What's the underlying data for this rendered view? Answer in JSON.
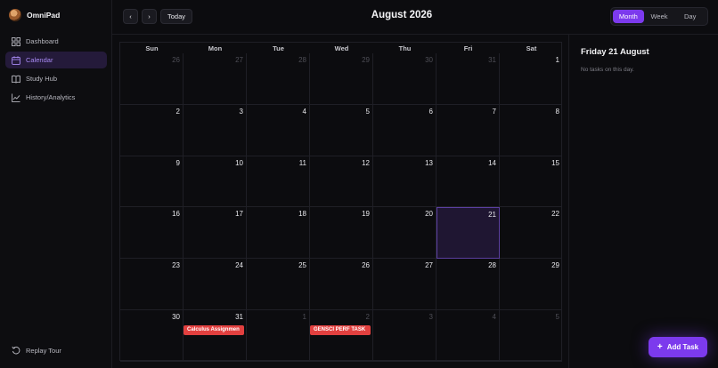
{
  "app": {
    "name": "OmniPad"
  },
  "sidebar": {
    "items": [
      {
        "label": "Dashboard",
        "icon": "dashboard-icon",
        "active": false
      },
      {
        "label": "Calendar",
        "icon": "calendar-icon",
        "active": true
      },
      {
        "label": "Study Hub",
        "icon": "book-icon",
        "active": false
      },
      {
        "label": "History/Analytics",
        "icon": "chart-icon",
        "active": false
      }
    ],
    "replay_label": "Replay Tour"
  },
  "header": {
    "prev_label": "‹",
    "next_label": "›",
    "today_label": "Today",
    "month_title": "August 2026",
    "views": [
      "Month",
      "Week",
      "Day"
    ],
    "active_view": "Month"
  },
  "calendar": {
    "weekdays": [
      "Sun",
      "Mon",
      "Tue",
      "Wed",
      "Thu",
      "Fri",
      "Sat"
    ],
    "weeks": [
      [
        {
          "d": "26",
          "out": true
        },
        {
          "d": "27",
          "out": true
        },
        {
          "d": "28",
          "out": true
        },
        {
          "d": "29",
          "out": true
        },
        {
          "d": "30",
          "out": true
        },
        {
          "d": "31",
          "out": true
        },
        {
          "d": "1"
        }
      ],
      [
        {
          "d": "2"
        },
        {
          "d": "3"
        },
        {
          "d": "4"
        },
        {
          "d": "5"
        },
        {
          "d": "6"
        },
        {
          "d": "7"
        },
        {
          "d": "8"
        }
      ],
      [
        {
          "d": "9"
        },
        {
          "d": "10"
        },
        {
          "d": "11"
        },
        {
          "d": "12"
        },
        {
          "d": "13"
        },
        {
          "d": "14"
        },
        {
          "d": "15"
        }
      ],
      [
        {
          "d": "16"
        },
        {
          "d": "17"
        },
        {
          "d": "18"
        },
        {
          "d": "19"
        },
        {
          "d": "20"
        },
        {
          "d": "21",
          "selected": true
        },
        {
          "d": "22"
        }
      ],
      [
        {
          "d": "23"
        },
        {
          "d": "24"
        },
        {
          "d": "25"
        },
        {
          "d": "26"
        },
        {
          "d": "27"
        },
        {
          "d": "28"
        },
        {
          "d": "29"
        }
      ],
      [
        {
          "d": "30"
        },
        {
          "d": "31",
          "task": "Calculus Assignmen"
        },
        {
          "d": "1",
          "out": true
        },
        {
          "d": "2",
          "out": true,
          "task": "GENSCI PERF TASK"
        },
        {
          "d": "3",
          "out": true
        },
        {
          "d": "4",
          "out": true
        },
        {
          "d": "5",
          "out": true
        }
      ]
    ],
    "task_color": "#e2403f",
    "accent": "#7c3aed"
  },
  "panel": {
    "title": "Friday 21 August",
    "empty_text": "No tasks on this day."
  },
  "add_task_label": "Add Task"
}
